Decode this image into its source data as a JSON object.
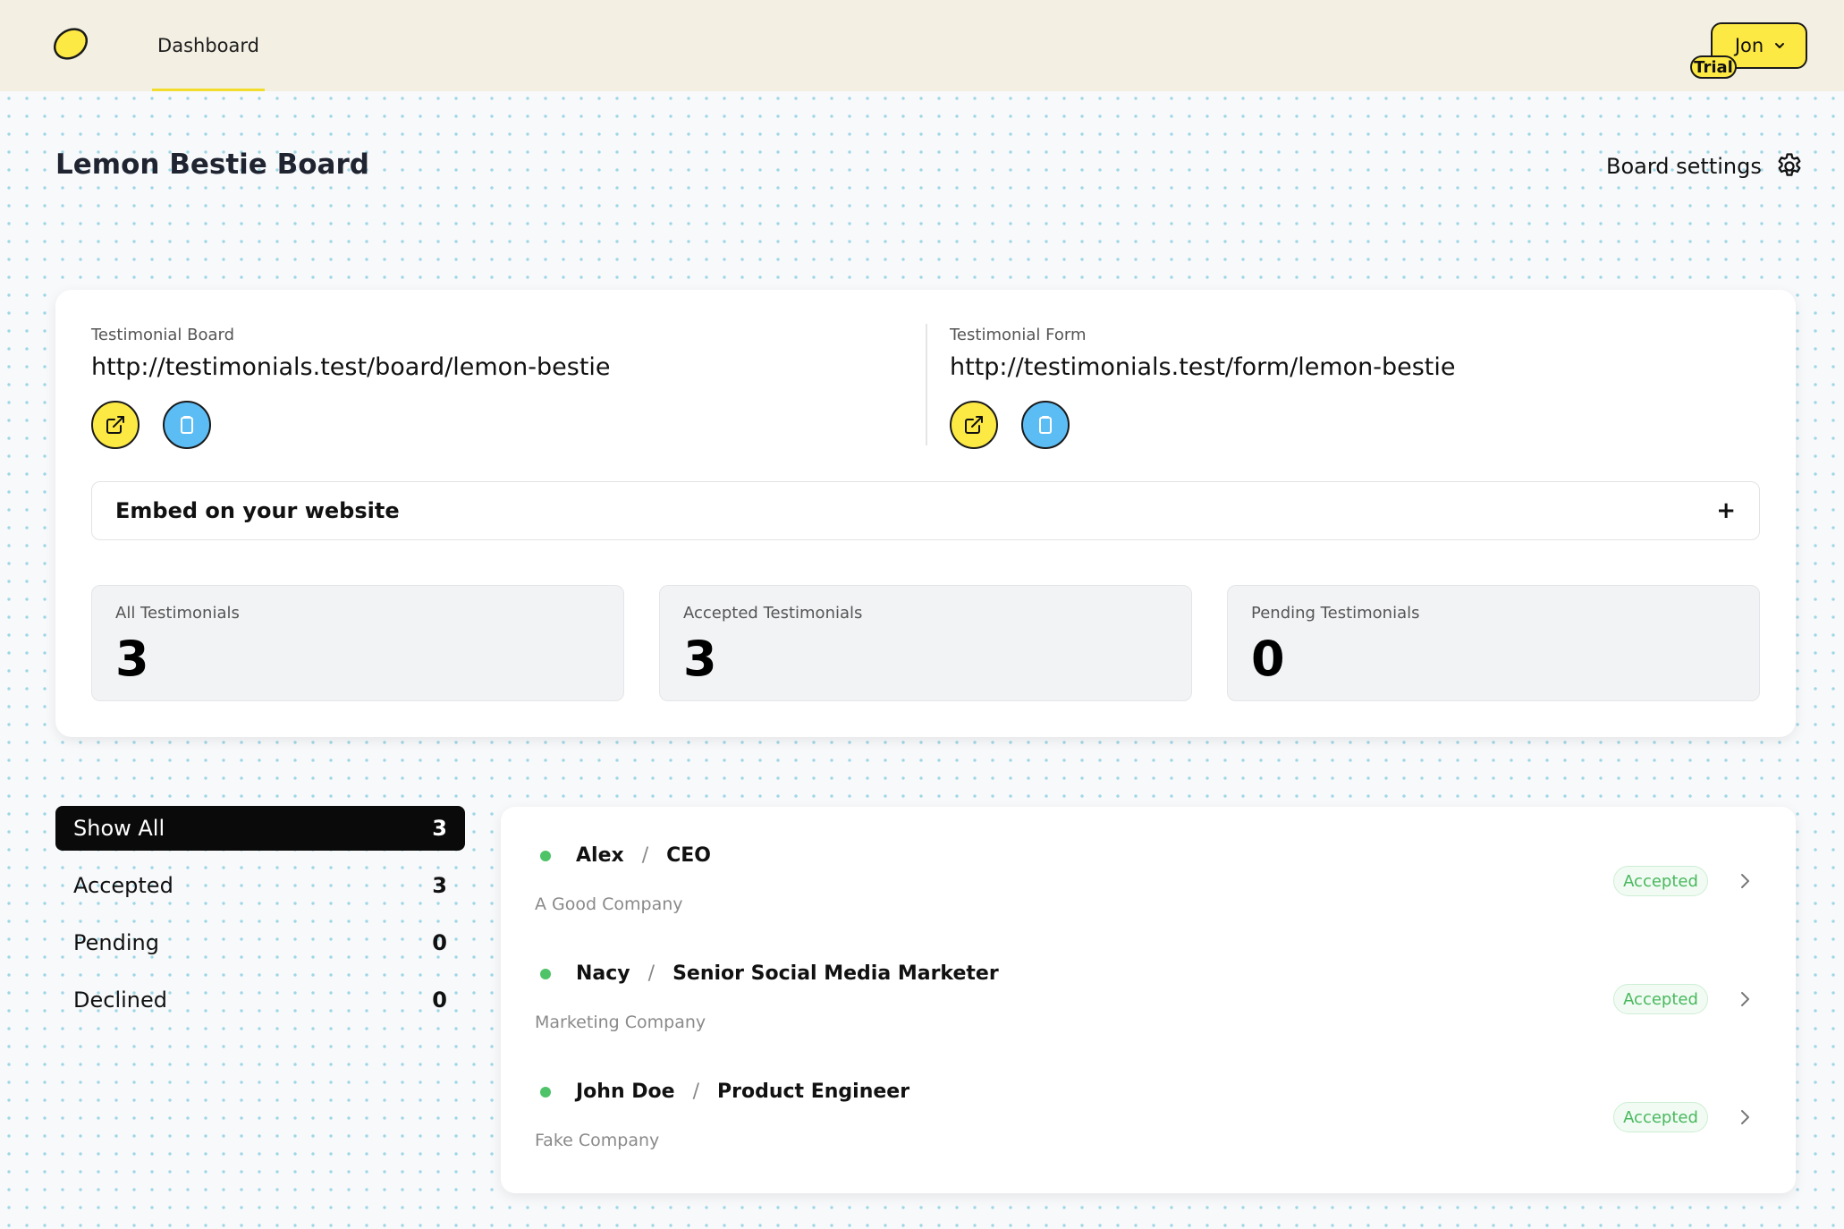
{
  "header": {
    "nav_dashboard": "Dashboard",
    "user_name": "Jon",
    "plan_badge": "Trial",
    "brand_color": "#fde944",
    "logo_icon": "lemon-icon"
  },
  "page": {
    "title": "Lemon Bestie Board",
    "settings_label": "Board settings"
  },
  "links": {
    "board": {
      "label": "Testimonial Board",
      "url": "http://testimonials.test/board/lemon-bestie"
    },
    "form": {
      "label": "Testimonial Form",
      "url": "http://testimonials.test/form/lemon-bestie"
    }
  },
  "embed": {
    "label": "Embed on your website",
    "toggle": "+"
  },
  "stats": [
    {
      "label": "All Testimonials",
      "value": "3"
    },
    {
      "label": "Accepted Testimonials",
      "value": "3"
    },
    {
      "label": "Pending Testimonials",
      "value": "0"
    }
  ],
  "filters": [
    {
      "label": "Show All",
      "count": "3",
      "active": true
    },
    {
      "label": "Accepted",
      "count": "3",
      "active": false
    },
    {
      "label": "Pending",
      "count": "0",
      "active": false
    },
    {
      "label": "Declined",
      "count": "0",
      "active": false
    }
  ],
  "testimonials": [
    {
      "name": "Alex",
      "separator": "/",
      "role": "CEO",
      "company": "A Good Company",
      "status": "Accepted"
    },
    {
      "name": "Nacy",
      "separator": "/",
      "role": "Senior Social Media Marketer",
      "company": "Marketing Company",
      "status": "Accepted"
    },
    {
      "name": "John Doe",
      "separator": "/",
      "role": "Product Engineer",
      "company": "Fake Company",
      "status": "Accepted"
    }
  ]
}
